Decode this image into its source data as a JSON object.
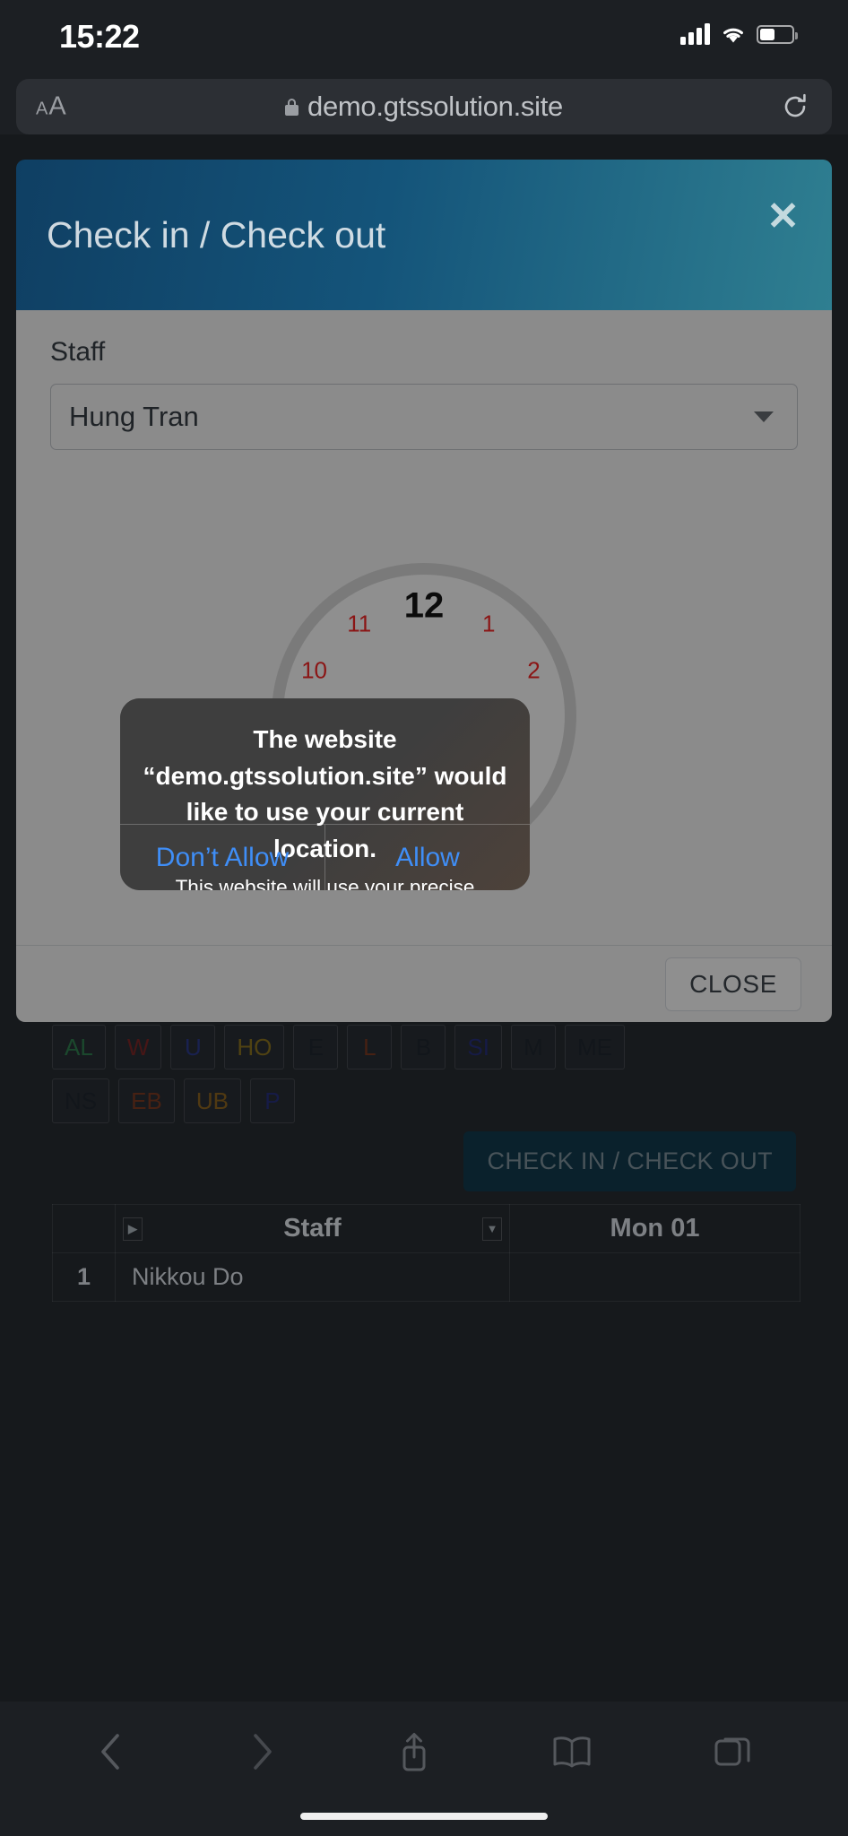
{
  "status_bar": {
    "time": "15:22",
    "signal_icon": "cellular-signal-icon",
    "wifi_icon": "wifi-icon",
    "battery_icon": "battery-icon"
  },
  "browser": {
    "text_size_small": "A",
    "text_size_large": "A",
    "lock_icon": "lock-icon",
    "url": "demo.gtssolution.site",
    "reload_icon": "reload-icon",
    "toolbar": {
      "back_icon": "chevron-left-icon",
      "forward_icon": "chevron-right-icon",
      "share_icon": "share-icon",
      "bookmarks_icon": "book-icon",
      "tabs_icon": "tabs-icon"
    }
  },
  "modal": {
    "title": "Check in / Check out",
    "close_icon": "close-icon",
    "staff_label": "Staff",
    "staff_value": "Hung Tran",
    "staff_caret_icon": "chevron-down-icon",
    "close_button": "CLOSE",
    "clock": {
      "numbers": [
        "12",
        "1",
        "2",
        "10",
        "11"
      ]
    }
  },
  "alert": {
    "title": "The website “demo.gtssolution.site” would like to use your current location.",
    "message": "This website will use your precise location because “Safari” currently has access to your precise location.",
    "deny_label": "Don’t Allow",
    "allow_label": "Allow",
    "button_color": "#3f8ef7"
  },
  "page": {
    "tags": [
      {
        "label": "AL",
        "color": "#2f7d4e"
      },
      {
        "label": "W",
        "color": "#7a2727"
      },
      {
        "label": "U",
        "color": "#2b3a8a"
      },
      {
        "label": "HO",
        "color": "#8a7320"
      },
      {
        "label": "E",
        "color": "#1f2630"
      },
      {
        "label": "L",
        "color": "#7a3a22"
      },
      {
        "label": "B",
        "color": "#1f2630"
      },
      {
        "label": "SI",
        "color": "#27307a"
      },
      {
        "label": "M",
        "color": "#1f2630"
      },
      {
        "label": "ME",
        "color": "#1f2630"
      },
      {
        "label": "NS",
        "color": "#1f2630"
      },
      {
        "label": "EB",
        "color": "#7a3a22"
      },
      {
        "label": "UB",
        "color": "#8a6320"
      },
      {
        "label": "P",
        "color": "#27307a"
      }
    ],
    "check_button": "CHECK IN / CHECK OUT",
    "table": {
      "headers": [
        "",
        "Staff",
        "Mon 01"
      ],
      "rows": [
        {
          "index": "1",
          "staff": "Nikkou Do",
          "mon01": ""
        }
      ]
    }
  }
}
